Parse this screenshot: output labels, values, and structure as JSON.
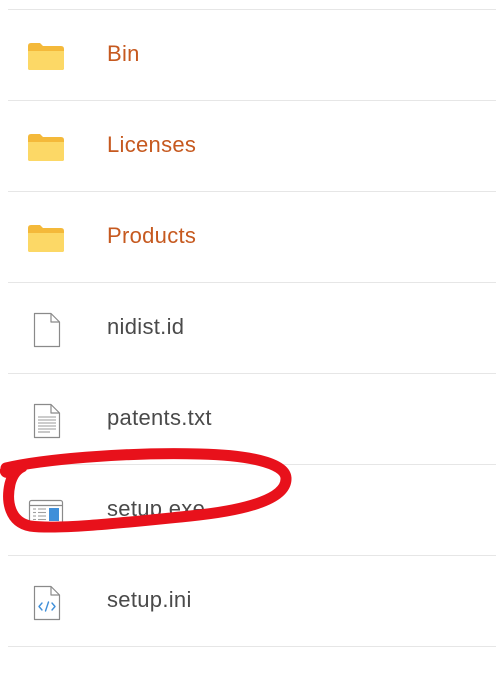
{
  "colors": {
    "folder_label": "#c6591f",
    "file_label": "#4a4a4a",
    "folder_icon": "#fcd15a",
    "annotation": "#e8111b"
  },
  "files": [
    {
      "name": "Bin",
      "kind": "folder",
      "icon": "folder-icon"
    },
    {
      "name": "Licenses",
      "kind": "folder",
      "icon": "folder-icon"
    },
    {
      "name": "Products",
      "kind": "folder",
      "icon": "folder-icon"
    },
    {
      "name": "nidist.id",
      "kind": "file",
      "icon": "blank-document-icon"
    },
    {
      "name": "patents.txt",
      "kind": "file",
      "icon": "text-document-icon"
    },
    {
      "name": "setup.exe",
      "kind": "file",
      "icon": "application-icon",
      "annotated": true
    },
    {
      "name": "setup.ini",
      "kind": "file",
      "icon": "code-document-icon"
    }
  ]
}
